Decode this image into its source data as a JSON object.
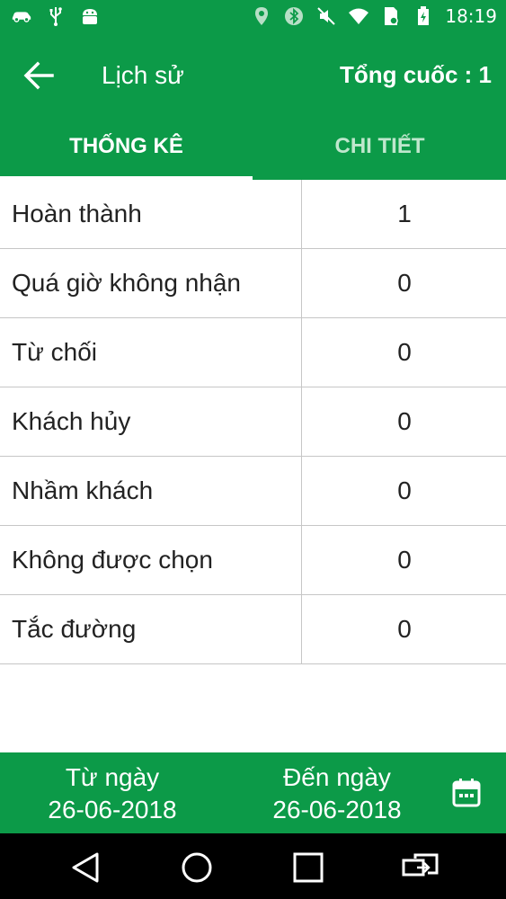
{
  "status_bar": {
    "time": "18:19",
    "left_icons": [
      "car-icon",
      "usb-icon",
      "android-icon"
    ],
    "right_icons": [
      "location-icon",
      "bluetooth-icon",
      "mute-icon",
      "wifi-icon",
      "sim-icon",
      "battery-icon"
    ]
  },
  "app_bar": {
    "back_icon": "arrow-left-icon",
    "title": "Lịch sử",
    "total": "Tổng cuốc : 1"
  },
  "tabs": [
    {
      "label": "THỐNG KÊ",
      "selected": true
    },
    {
      "label": "CHI TIẾT",
      "selected": false
    }
  ],
  "stats": [
    {
      "label": "Hoàn thành",
      "value": "1"
    },
    {
      "label": "Quá giờ không nhận",
      "value": "0"
    },
    {
      "label": "Từ chối",
      "value": "0"
    },
    {
      "label": "Khách hủy",
      "value": "0"
    },
    {
      "label": "Nhầm khách",
      "value": "0"
    },
    {
      "label": "Không được chọn",
      "value": "0"
    },
    {
      "label": "Tắc đường",
      "value": "0"
    }
  ],
  "date_range": {
    "from_label": "Từ ngày",
    "from_date": "26-06-2018",
    "to_label": "Đến ngày",
    "to_date": "26-06-2018",
    "calendar_icon": "calendar-icon"
  },
  "nav_bar": {
    "icons": [
      "back-triangle-icon",
      "home-circle-icon",
      "recents-square-icon",
      "switch-app-icon"
    ]
  },
  "colors": {
    "primary": "#0c9a48",
    "tab_inactive_text": "#bfe7cd",
    "divider": "#c6c6c6",
    "nav_bar": "#000000"
  }
}
